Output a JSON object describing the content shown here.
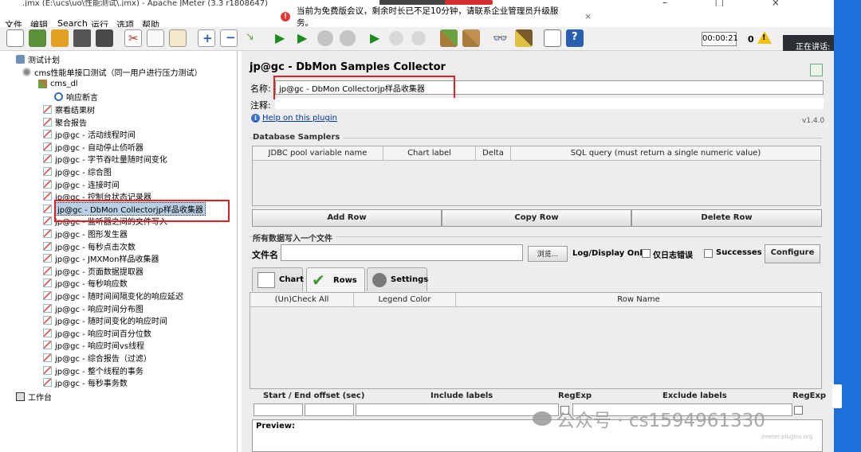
{
  "window": {
    "title": ".jmx (E:\\ucs\\uo\\性能测试\\.jmx) - Apache JMeter (3.3 r1808647)",
    "controls": "–  □  ×"
  },
  "menu": [
    "文件",
    "编辑",
    "Search",
    "运行",
    "选项",
    "帮助"
  ],
  "notice": {
    "text": "当前为免费版会议，剩余时长已不足10分钟，请联系企业管理员升级服务。",
    "close": "×"
  },
  "toolbar": {
    "timer": "00:00:21",
    "warning_count": "0",
    "warning_glyph": "!",
    "icons": [
      "new-icon",
      "templates-icon",
      "open-icon",
      "save-icon",
      "save-as-icon",
      "cut-icon",
      "copy-icon",
      "paste-icon",
      "expand-icon",
      "collapse-icon",
      "toggle-icon",
      "start-icon",
      "start-no-pause-icon",
      "stop-icon",
      "shutdown-icon",
      "remote-start-icon",
      "remote-stop-icon",
      "remote-shutdown-icon",
      "clear-icon",
      "clear-all-icon",
      "search-icon",
      "reset-search-icon",
      "function-helper-icon",
      "help-icon"
    ]
  },
  "meeting": {
    "speaking": "正在讲话: 肖"
  },
  "tree": {
    "items": [
      {
        "label": "测试计划",
        "icon": "test-plan-icon"
      },
      {
        "label": "cms性能单接口测试（同一用户进行压力测试）",
        "icon": "thread-group-icon"
      },
      {
        "label": "cms_dl",
        "icon": "sampler-icon"
      },
      {
        "label": "响应断言",
        "icon": "assertion-icon"
      },
      {
        "label": "察看结果树",
        "icon": "listener-icon"
      },
      {
        "label": "聚合报告",
        "icon": "listener-icon"
      },
      {
        "label": "jp@gc - 活动线程时间",
        "icon": "listener-icon"
      },
      {
        "label": "jp@gc - 自动停止侦听器",
        "icon": "listener-icon"
      },
      {
        "label": "jp@gc - 字节吞吐量随时间变化",
        "icon": "listener-icon"
      },
      {
        "label": "jp@gc - 综合图",
        "icon": "listener-icon"
      },
      {
        "label": "jp@gc - 连接时间",
        "icon": "listener-icon"
      },
      {
        "label": "jp@gc - 控制台状态记录器",
        "icon": "listener-icon"
      },
      {
        "label": "jp@gc - DbMon Collectorjp样品收集器",
        "icon": "listener-icon"
      },
      {
        "label": "jp@gc - 监听器之间的文件写入",
        "icon": "listener-icon"
      },
      {
        "label": "jp@gc - 图形发生器",
        "icon": "listener-icon"
      },
      {
        "label": "jp@gc - 每秒点击次数",
        "icon": "listener-icon"
      },
      {
        "label": "jp@gc - JMXMon样品收集器",
        "icon": "listener-icon"
      },
      {
        "label": "jp@gc - 页面数据提取器",
        "icon": "listener-icon"
      },
      {
        "label": "jp@gc - 每秒响应数",
        "icon": "listener-icon"
      },
      {
        "label": "jp@gc - 随时间间隔变化的响应延迟",
        "icon": "listener-icon"
      },
      {
        "label": "jp@gc - 响应时间分布图",
        "icon": "listener-icon"
      },
      {
        "label": "jp@gc - 随时间变化的响应时间",
        "icon": "listener-icon"
      },
      {
        "label": "jp@gc - 响应时间百分位数",
        "icon": "listener-icon"
      },
      {
        "label": "jp@gc - 响应时间vs线程",
        "icon": "listener-icon"
      },
      {
        "label": "jp@gc - 综合报告（过滤）",
        "icon": "listener-icon"
      },
      {
        "label": "jp@gc - 整个线程的事务",
        "icon": "listener-icon"
      },
      {
        "label": "jp@gc - 每秒事务数",
        "icon": "listener-icon"
      },
      {
        "label": "工作台",
        "icon": "workbench-icon"
      }
    ],
    "selected": "jp@gc - DbMon Collectorjp样品收集器"
  },
  "panel": {
    "title": "jp@gc - DbMon Samples Collector",
    "name_label": "名称:",
    "name_value": "jp@gc - DbMon Collectorjp样品收集器",
    "comment_label": "注释:",
    "help": "Help on this plugin",
    "version": "v1.4.0",
    "db_section": "Database Samplers",
    "db_columns": [
      "JDBC pool variable name",
      "Chart label",
      "Delta",
      "SQL query (must return a single numeric value)"
    ],
    "buttons": {
      "add": "Add Row",
      "copy": "Copy Row",
      "delete": "Delete Row"
    },
    "file_section": "所有数据写入一个文件",
    "file_label": "文件名",
    "browse": "浏览...",
    "log_only": "Log/Display Only:",
    "errors_only": "仅日志错误",
    "successes": "Successes",
    "configure": "Configure",
    "tabs": [
      "Chart",
      "Rows",
      "Settings"
    ],
    "rows_columns": [
      "(Un)Check All",
      "Legend Color",
      "Row Name"
    ],
    "offsets": {
      "start_end": "Start / End offset (sec)",
      "include": "Include labels",
      "regexp1": "RegExp",
      "exclude": "Exclude labels",
      "regexp2": "RegExp"
    },
    "preview": "Preview:"
  },
  "watermark": {
    "text": "公众号 · cs1594961330",
    "site": "jmeter-plugins.org"
  },
  "colors": {
    "selection": "#b8cfe5",
    "annotation_red": "#e02020",
    "accent_blue": "#1e6fd9"
  }
}
